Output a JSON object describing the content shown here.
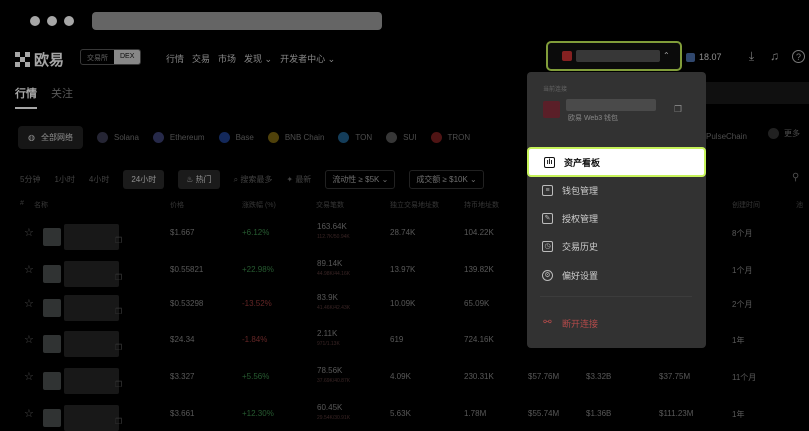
{
  "header": {
    "logo_text": "欧易",
    "seg_exchange": "交易所",
    "seg_dex": "DEX",
    "nav_links": [
      "行情",
      "交易",
      "市场",
      "发现 ⌄",
      "开发者中心 ⌄"
    ],
    "balance": "18.07"
  },
  "tabs": [
    "行情",
    "关注"
  ],
  "networks": [
    "全部网络",
    "Solana",
    "Ethereum",
    "Base",
    "BNB Chain",
    "TON",
    "SUI",
    "TRON",
    "PulseChain",
    "更多"
  ],
  "filters": {
    "times": [
      "5分钟",
      "1小时",
      "4小时",
      "24小时"
    ],
    "hot": "热门",
    "search_most": "搜索最多",
    "latest": "最新",
    "liquidity": "流动性 ≥ $5K ⌄",
    "volume": "成交额 ≥ $10K ⌄"
  },
  "table": {
    "headers": [
      "名称",
      "价格",
      "涨跌幅 (%)",
      "交易笔数",
      "独立交易地址数",
      "持币地址数",
      "",
      "",
      "",
      "创建时间",
      "池"
    ],
    "rows": [
      {
        "price": "$1.667",
        "change": "+6.12%",
        "dir": "pos",
        "trades": "163.64K",
        "trades_sub": "112.7K/50.94K",
        "addrs": "28.74K",
        "holders": "104.22K",
        "c7": "",
        "c8": "",
        "c9": "",
        "age": "8个月"
      },
      {
        "price": "$0.55821",
        "change": "+22.98%",
        "dir": "pos",
        "trades": "89.14K",
        "trades_sub": "44.98K/44.16K",
        "addrs": "13.97K",
        "holders": "139.82K",
        "c7": "",
        "c8": "",
        "c9": "",
        "age": "1个月"
      },
      {
        "price": "$0.53298",
        "change": "-13.52%",
        "dir": "neg",
        "trades": "83.9K",
        "trades_sub": "41.46K/42.43K",
        "addrs": "10.09K",
        "holders": "65.09K",
        "c7": "",
        "c8": "",
        "c9": "",
        "age": "2个月"
      },
      {
        "price": "$24.34",
        "change": "-1.84%",
        "dir": "neg",
        "trades": "2.11K",
        "trades_sub": "971/1.13K",
        "addrs": "619",
        "holders": "724.16K",
        "c7": "",
        "c8": "",
        "c9": "",
        "age": "1年"
      },
      {
        "price": "$3.327",
        "change": "+5.56%",
        "dir": "pos",
        "trades": "78.56K",
        "trades_sub": "37.69K/40.87K",
        "addrs": "4.09K",
        "holders": "230.31K",
        "c7": "$57.76M",
        "c8": "$3.32B",
        "c9": "$37.75M",
        "age": "11个月"
      },
      {
        "price": "$3.661",
        "change": "+12.30%",
        "dir": "pos",
        "trades": "60.45K",
        "trades_sub": "29.54K/30.91K",
        "addrs": "5.63K",
        "holders": "1.78M",
        "c7": "$55.74M",
        "c8": "$1.36B",
        "c9": "$111.23M",
        "age": "1年"
      }
    ]
  },
  "menu": {
    "label": "当前连接",
    "wallet_sub": "欧易 Web3 钱包",
    "items": [
      "资产看板",
      "钱包管理",
      "授权管理",
      "交易历史",
      "偏好设置"
    ],
    "disconnect": "断开连接"
  },
  "colors": {
    "highlight": "#c6f25a",
    "positive": "#3b8a4a",
    "negative": "#9a3b3b"
  }
}
